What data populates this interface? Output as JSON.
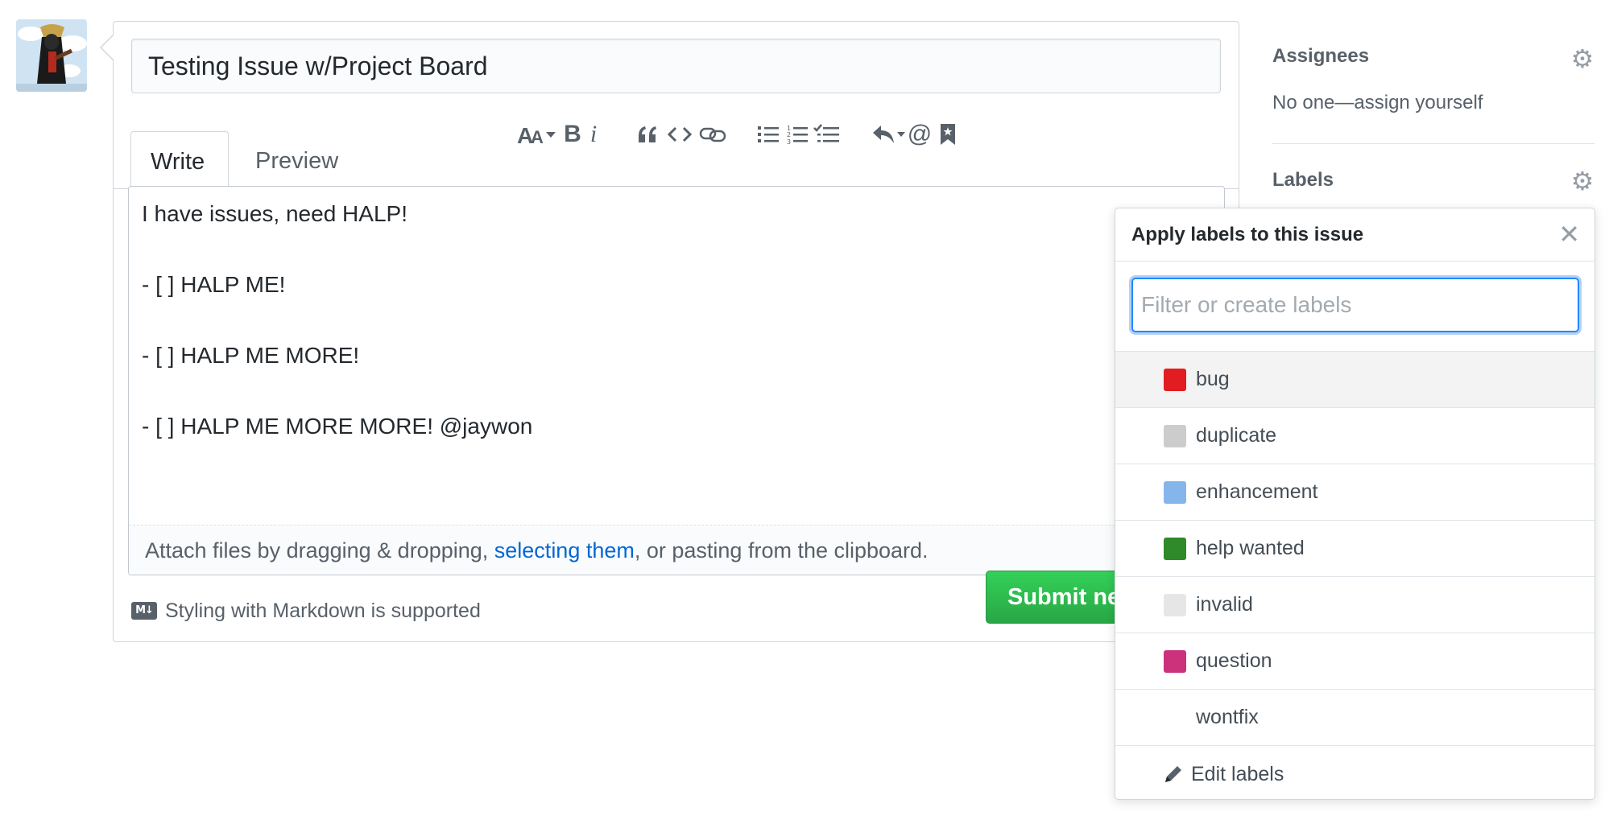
{
  "issue": {
    "title": "Testing Issue w/Project Board",
    "tabs": {
      "write": "Write",
      "preview": "Preview"
    },
    "toolbar": {
      "header_icon": "text-size-icon",
      "bold_label": "B",
      "italic_label": "i",
      "quote_icon": "quote-icon",
      "code_icon": "code-icon",
      "link_icon": "link-icon",
      "unordered_list_icon": "list-unordered-icon",
      "ordered_list_icon": "list-ordered-icon",
      "tasklist_icon": "tasklist-icon",
      "reply_icon": "reply-icon",
      "mention_label": "@",
      "saved_replies_icon": "bookmark-icon"
    },
    "body_lines": [
      "I have issues, need HALP!",
      "- [ ] HALP ME!",
      "- [ ] HALP ME MORE!",
      "- [ ] HALP ME MORE MORE! @jaywon"
    ],
    "attach": {
      "before": "Attach files by dragging & dropping, ",
      "link": "selecting them",
      "after": ", or pasting from the clipboard."
    },
    "markdown_note": "Styling with Markdown is supported",
    "markdown_icon": "markdown-icon",
    "submit_label": "Submit new issue"
  },
  "sidebar": {
    "assignees_heading": "Assignees",
    "assignees_value": "No one—assign yourself",
    "labels_heading": "Labels"
  },
  "label_popup": {
    "header": "Apply labels to this issue",
    "filter_placeholder": "Filter or create labels",
    "labels": [
      {
        "name": "bug",
        "color": "#e11d21"
      },
      {
        "name": "duplicate",
        "color": "#cccccc"
      },
      {
        "name": "enhancement",
        "color": "#84b6eb"
      },
      {
        "name": "help wanted",
        "color": "#2f8a2a"
      },
      {
        "name": "invalid",
        "color": "#e6e6e6"
      },
      {
        "name": "question",
        "color": "#cc317c"
      },
      {
        "name": "wontfix",
        "color": "#ffffff"
      }
    ],
    "edit_label": "Edit labels"
  },
  "colors": {
    "accent_link": "#0366d6",
    "submit_green": "#28a745",
    "focus_blue": "#2188ff"
  }
}
